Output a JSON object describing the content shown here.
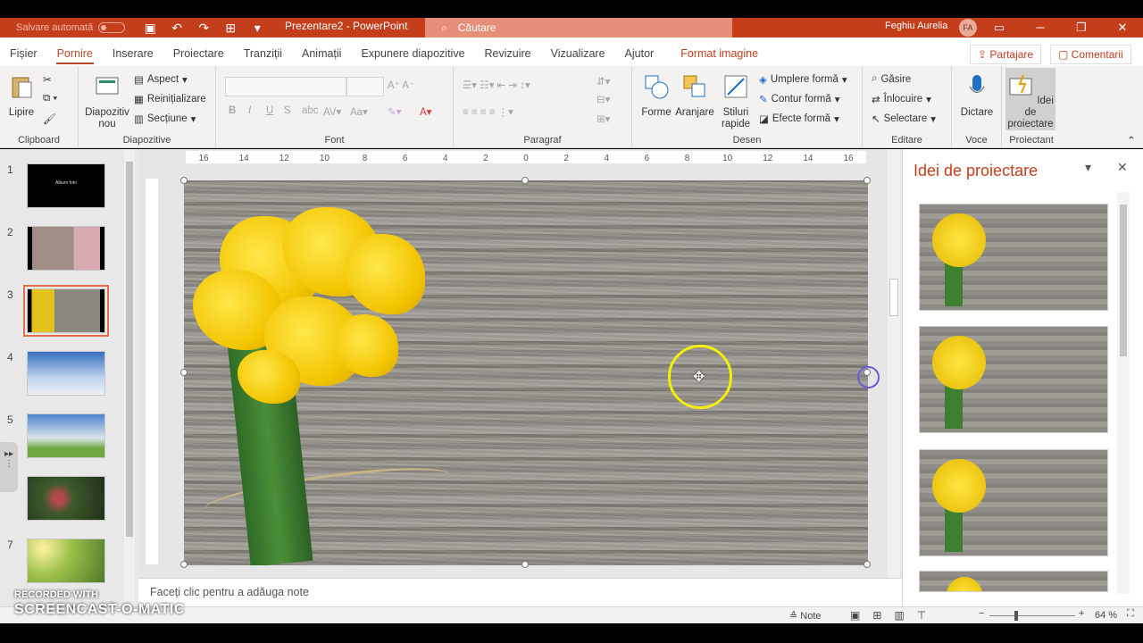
{
  "titlebar": {
    "autosave": "Salvare automată",
    "document": "Prezentare2 - PowerPoint",
    "search_placeholder": "Căutare",
    "user_name": "Feghiu Aurelia",
    "user_initials": "FA"
  },
  "tabs": [
    "Fișier",
    "Pornire",
    "Inserare",
    "Proiectare",
    "Tranziții",
    "Animații",
    "Expunere diapozitive",
    "Revizuire",
    "Vizualizare",
    "Ajutor"
  ],
  "context_tab": "Format imagine",
  "share_label": "Partajare",
  "comments_label": "Comentarii",
  "ribbon": {
    "clipboard": {
      "label": "Clipboard",
      "paste": "Lipire"
    },
    "slides": {
      "label": "Diapozitive",
      "new_slide": "Diapozitiv nou",
      "layout": "Aspect",
      "reset": "Reinițializare",
      "section": "Secțiune"
    },
    "font": {
      "label": "Font"
    },
    "paragraph": {
      "label": "Paragraf"
    },
    "drawing": {
      "label": "Desen",
      "shapes": "Forme",
      "arrange": "Aranjare",
      "quick_styles": "Stiluri rapide",
      "shape_fill": "Umplere formă",
      "shape_outline": "Contur formă",
      "shape_effects": "Efecte formă"
    },
    "editing": {
      "label": "Editare",
      "find": "Găsire",
      "replace": "Înlocuire",
      "select": "Selectare"
    },
    "voice": {
      "label": "Voce",
      "dictate": "Dictare"
    },
    "designer": {
      "label": "Proiectant",
      "design_ideas": "Idei de proiectare"
    }
  },
  "slides": [
    1,
    2,
    3,
    4,
    5,
    6,
    7
  ],
  "selected_slide": 3,
  "thumbnail_1_text": "Album foto",
  "ruler_labels": [
    "16",
    "14",
    "12",
    "10",
    "8",
    "6",
    "4",
    "2",
    "0",
    "2",
    "4",
    "6",
    "8",
    "10",
    "12",
    "14",
    "16"
  ],
  "notes_placeholder": "Faceți clic pentru a adăuga note",
  "design_pane": {
    "title": "Idei de proiectare"
  },
  "statusbar": {
    "notes": "Note",
    "zoom": "64 %"
  },
  "watermark": {
    "line1": "RECORDED WITH",
    "line2": "SCREENCAST-O-MATIC"
  },
  "colors": {
    "accent": "#c43e1c",
    "selection": "#e26d4e"
  }
}
